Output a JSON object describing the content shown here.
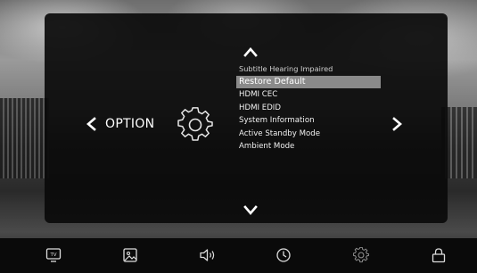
{
  "menu": {
    "title": "OPTION",
    "items": [
      {
        "label": "Subtitle Hearing Impaired",
        "state": "dim"
      },
      {
        "label": "Restore Default",
        "state": "selected"
      },
      {
        "label": "HDMI CEC",
        "state": "normal"
      },
      {
        "label": "HDMI EDID",
        "state": "normal"
      },
      {
        "label": "System Information",
        "state": "normal"
      },
      {
        "label": "Active Standby Mode",
        "state": "normal"
      },
      {
        "label": "Ambient Mode",
        "state": "normal"
      }
    ]
  },
  "icons": {
    "left": "chevron-left-icon",
    "right": "chevron-right-icon",
    "up": "chevron-up-icon",
    "down": "chevron-down-icon",
    "category": "gear-icon"
  },
  "bottom_bar": {
    "items": [
      {
        "name": "tv",
        "icon": "tv-icon",
        "text": "TV"
      },
      {
        "name": "picture",
        "icon": "picture-icon"
      },
      {
        "name": "sound",
        "icon": "sound-icon"
      },
      {
        "name": "time",
        "icon": "clock-icon"
      },
      {
        "name": "setup",
        "icon": "gear-icon"
      },
      {
        "name": "lock",
        "icon": "lock-icon"
      }
    ]
  },
  "colors": {
    "selection": "#8a8a8a",
    "panel": "#0a0a0a"
  }
}
